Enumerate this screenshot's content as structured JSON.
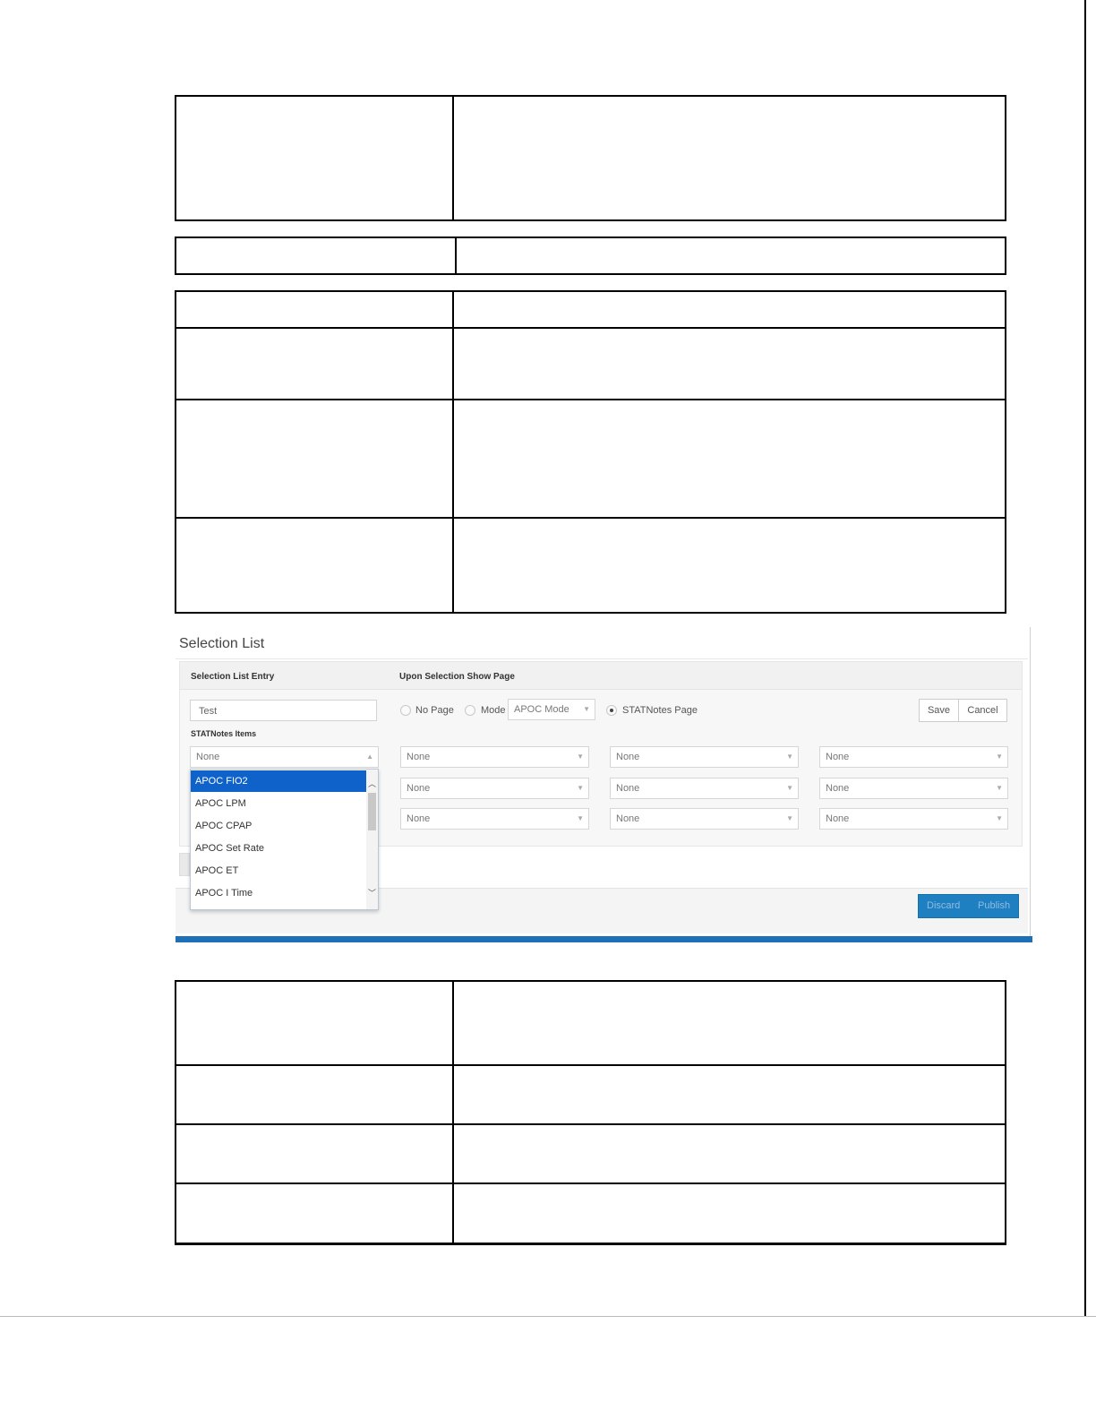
{
  "panel": {
    "title": "Selection List",
    "entry_label": "Selection List Entry",
    "show_page_label": "Upon Selection Show Page",
    "entry_value": "Test",
    "items_label": "STATNotes Items",
    "options": {
      "no_page": "No Page",
      "mode": "Mode",
      "mode_select": "APOC Mode",
      "statnotes_page": "STATNotes Page"
    },
    "save_label": "Save",
    "cancel_label": "Cancel",
    "discard_label": "Discard",
    "publish_label": "Publish",
    "select_value": "None",
    "dropdown_items": [
      "APOC FIO2",
      "APOC LPM",
      "APOC CPAP",
      "APOC Set Rate",
      "APOC ET",
      "APOC I Time"
    ],
    "dropdown_selected": "APOC FIO2"
  }
}
